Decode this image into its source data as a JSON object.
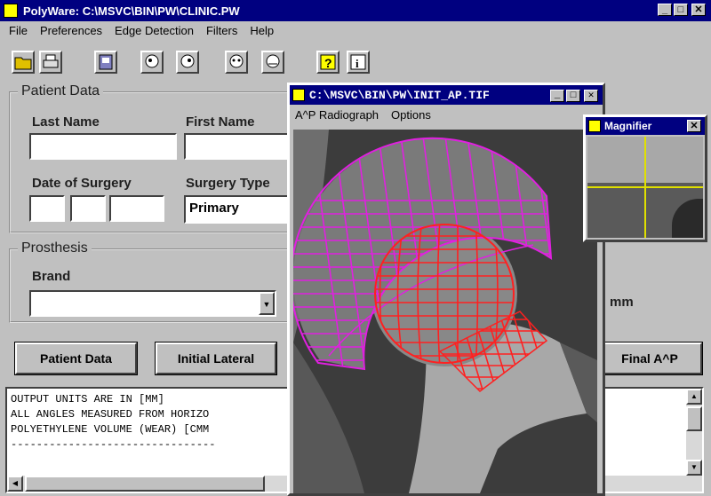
{
  "main_window": {
    "title": "PolyWare: C:\\MSVC\\BIN\\PW\\CLINIC.PW",
    "menu": [
      "File",
      "Preferences",
      "Edge Detection",
      "Filters",
      "Help"
    ]
  },
  "toolbar_icons": [
    "open-folder-icon",
    "print-icon",
    "record-icon",
    "skull-left-icon",
    "skull-right-icon",
    "skull-front-icon",
    "skull-back-icon",
    "help-icon",
    "info-icon"
  ],
  "patient": {
    "group_title": "Patient Data",
    "last_name_label": "Last Name",
    "first_name_label": "First Name",
    "date_label": "Date of Surgery",
    "surgery_type_label": "Surgery Type",
    "surgery_type_value": "Primary"
  },
  "prosthesis": {
    "group_title": "Prosthesis",
    "brand_label": "Brand",
    "unit": "mm"
  },
  "buttons": {
    "patient_data": "Patient Data",
    "initial_lateral": "Initial Lateral",
    "final_ap": "Final A^P"
  },
  "output_lines": [
    "OUTPUT UNITS ARE IN [MM]",
    "ALL ANGLES MEASURED FROM HORIZO",
    "POLYETHYLENE VOLUME (WEAR) [CMM",
    "--------------------------------"
  ],
  "image_window": {
    "title": "C:\\MSVC\\BIN\\PW\\INIT_AP.TIF",
    "menu": [
      "A^P Radiograph",
      "Options"
    ]
  },
  "magnifier": {
    "title": "Magnifier"
  },
  "colors": {
    "titlebar": "#000080",
    "face": "#c0c0c0",
    "cup_mesh": "#e020e0",
    "head_mesh": "#ff2020",
    "crosshair": "#e0e000"
  }
}
